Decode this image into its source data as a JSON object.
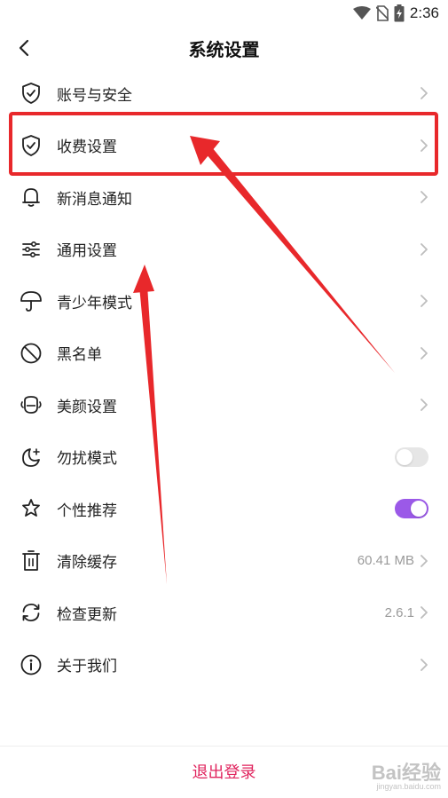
{
  "status_bar": {
    "time": "2:36"
  },
  "header": {
    "title": "系统设置"
  },
  "menu": [
    {
      "label": "账号与安全",
      "icon": "shield-check-icon",
      "right": "chevron"
    },
    {
      "label": "收费设置",
      "icon": "shield-check-icon",
      "right": "chevron"
    },
    {
      "label": "新消息通知",
      "icon": "bell-icon",
      "right": "chevron"
    },
    {
      "label": "通用设置",
      "icon": "sliders-icon",
      "right": "chevron"
    },
    {
      "label": "青少年模式",
      "icon": "umbrella-icon",
      "right": "chevron"
    },
    {
      "label": "黑名单",
      "icon": "block-icon",
      "right": "chevron"
    },
    {
      "label": "美颜设置",
      "icon": "beauty-icon",
      "right": "chevron"
    },
    {
      "label": "勿扰模式",
      "icon": "moon-icon",
      "right": "toggle",
      "toggle_on": false
    },
    {
      "label": "个性推荐",
      "icon": "sparkle-icon",
      "right": "toggle",
      "toggle_on": true
    },
    {
      "label": "清除缓存",
      "icon": "trash-icon",
      "right": "chevron",
      "value": "60.41 MB"
    },
    {
      "label": "检查更新",
      "icon": "refresh-icon",
      "right": "chevron",
      "value": "2.6.1"
    },
    {
      "label": "关于我们",
      "icon": "info-icon",
      "right": "chevron"
    }
  ],
  "footer": {
    "logout_label": "退出登录"
  },
  "colors": {
    "accent": "#e0245e",
    "toggle_on": "#9b59e8",
    "annotation_red": "#e8282b"
  },
  "watermark": {
    "text": "Bai经验",
    "sub": "jingyan.baidu.com"
  }
}
